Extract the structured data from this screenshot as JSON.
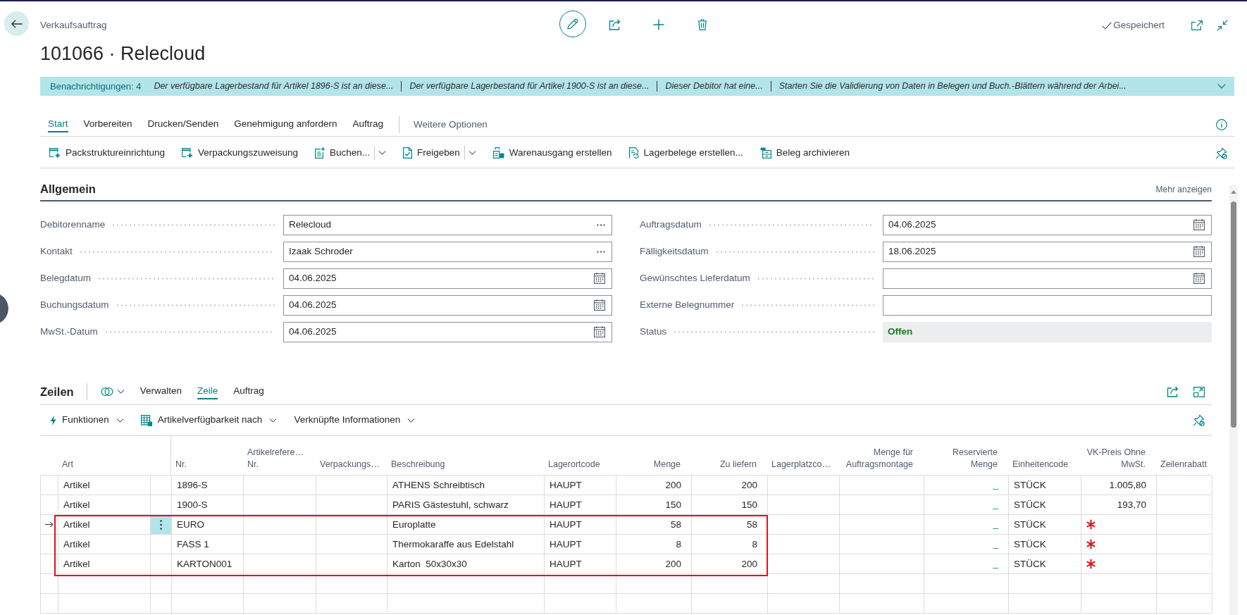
{
  "header": {
    "caption": "Verkaufsauftrag",
    "title": "101066 · Relecloud",
    "save_state": "Gespeichert"
  },
  "notifications": {
    "label": "Benachrichtigungen: 4",
    "messages": [
      "Der verfügbare Lagerbestand für Artikel 1896-S ist an diese...",
      "Der verfügbare Lagerbestand für Artikel 1900-S ist an diese...",
      "Dieser Debitor hat eine...",
      "Starten Sie die Validierung von Daten in Belegen und Buch.-Blättern während der Arbei..."
    ]
  },
  "tabs": [
    {
      "label": "Start",
      "selected": true
    },
    {
      "label": "Vorbereiten",
      "selected": false
    },
    {
      "label": "Drucken/Senden",
      "selected": false
    },
    {
      "label": "Genehmigung anfordern",
      "selected": false
    },
    {
      "label": "Auftrag",
      "selected": false
    }
  ],
  "more_options": "Weitere Optionen",
  "actions": [
    {
      "label": "Packstruktureinrichtung",
      "split": false
    },
    {
      "label": "Verpackungszuweisung",
      "split": false
    },
    {
      "label": "Buchen...",
      "split": true
    },
    {
      "label": "Freigeben",
      "split": true
    },
    {
      "label": "Warenausgang erstellen",
      "split": false
    },
    {
      "label": "Lagerbelege erstellen...",
      "split": false
    },
    {
      "label": "Beleg archivieren",
      "split": false
    }
  ],
  "general": {
    "title": "Allgemein",
    "show_more": "Mehr anzeigen",
    "left_fields": [
      {
        "label": "Debitorenname",
        "kind": "lookup",
        "value": "Relecloud"
      },
      {
        "label": "Kontakt",
        "kind": "lookup",
        "value": "Izaak Schroder"
      },
      {
        "label": "Belegdatum",
        "kind": "date",
        "value": "04.06.2025"
      },
      {
        "label": "Buchungsdatum",
        "kind": "date",
        "value": "04.06.2025"
      },
      {
        "label": "MwSt.-Datum",
        "kind": "date",
        "value": "04.06.2025"
      }
    ],
    "right_fields": [
      {
        "label": "Auftragsdatum",
        "kind": "date",
        "value": "04.06.2025"
      },
      {
        "label": "Fälligkeitsdatum",
        "kind": "date",
        "value": "18.06.2025"
      },
      {
        "label": "Gewünschtes Lieferdatum",
        "kind": "date"
      },
      {
        "label": "Externe Belegnummer",
        "kind": "text"
      },
      {
        "label": "Status",
        "kind": "status",
        "value": "Offen"
      }
    ]
  },
  "lines": {
    "title": "Zeilen",
    "tabs": [
      {
        "label": "Verwalten",
        "selected": false
      },
      {
        "label": "Zeile",
        "selected": true
      },
      {
        "label": "Auftrag",
        "selected": false
      }
    ],
    "actions": [
      {
        "label": "Funktionen"
      },
      {
        "label": "Artikelverfügbarkeit nach"
      },
      {
        "label": "Verknüpfte Informationen"
      }
    ],
    "table": {
      "columns": [
        {
          "label": "Art",
          "kind": "text"
        },
        {
          "label": "Nr.",
          "kind": "text"
        },
        {
          "label": "Artikelrefere… Nr.",
          "kind": "text"
        },
        {
          "label": "Verpackungs…",
          "kind": "text"
        },
        {
          "label": "Beschreibung",
          "kind": "text"
        },
        {
          "label": "Lagerortcode",
          "kind": "text"
        },
        {
          "label": "Menge",
          "kind": "number"
        },
        {
          "label": "Zu liefern",
          "kind": "number"
        },
        {
          "label": "Lagerplatzco…",
          "kind": "text"
        },
        {
          "label": "Menge für Auftragsmontage",
          "kind": "number"
        },
        {
          "label": "Reservierte Menge",
          "kind": "link"
        },
        {
          "label": "Einheitencode",
          "kind": "text"
        },
        {
          "label": "VK-Preis Ohne MwSt.",
          "kind": "number"
        },
        {
          "label": "Zeilenrabatt",
          "kind": "text"
        }
      ],
      "rows": [
        {
          "selected": false,
          "highlighted": false,
          "price_required": false,
          "cells": {
            "type": "Artikel",
            "no": "1896-S",
            "description": "ATHENS Schreibtisch",
            "location": "HAUPT",
            "quantity": "200",
            "to_ship": "200",
            "reserved": "_",
            "unit": "STÜCK",
            "unit_price": "1.005,80"
          }
        },
        {
          "selected": false,
          "highlighted": false,
          "price_required": false,
          "cells": {
            "type": "Artikel",
            "no": "1900-S",
            "description": "PARIS Gästestuhl, schwarz",
            "location": "HAUPT",
            "quantity": "150",
            "to_ship": "150",
            "reserved": "_",
            "unit": "STÜCK",
            "unit_price": "193,70"
          }
        },
        {
          "selected": true,
          "highlighted": true,
          "price_required": true,
          "cells": {
            "type": "Artikel",
            "no": "EURO",
            "description": "Europlatte",
            "location": "HAUPT",
            "quantity": "58",
            "to_ship": "58",
            "reserved": "_",
            "unit": "STÜCK"
          }
        },
        {
          "selected": false,
          "highlighted": true,
          "price_required": true,
          "cells": {
            "type": "Artikel",
            "no": "FASS 1",
            "description": "Thermokaraffe aus Edelstahl",
            "location": "HAUPT",
            "quantity": "8",
            "to_ship": "8",
            "reserved": "_",
            "unit": "STÜCK"
          }
        },
        {
          "selected": false,
          "highlighted": true,
          "price_required": true,
          "cells": {
            "type": "Artikel",
            "no": "KARTON001",
            "description": "Karton  50x30x30",
            "location": "HAUPT",
            "quantity": "200",
            "to_ship": "200",
            "reserved": "_",
            "unit": "STÜCK"
          }
        }
      ]
    }
  }
}
